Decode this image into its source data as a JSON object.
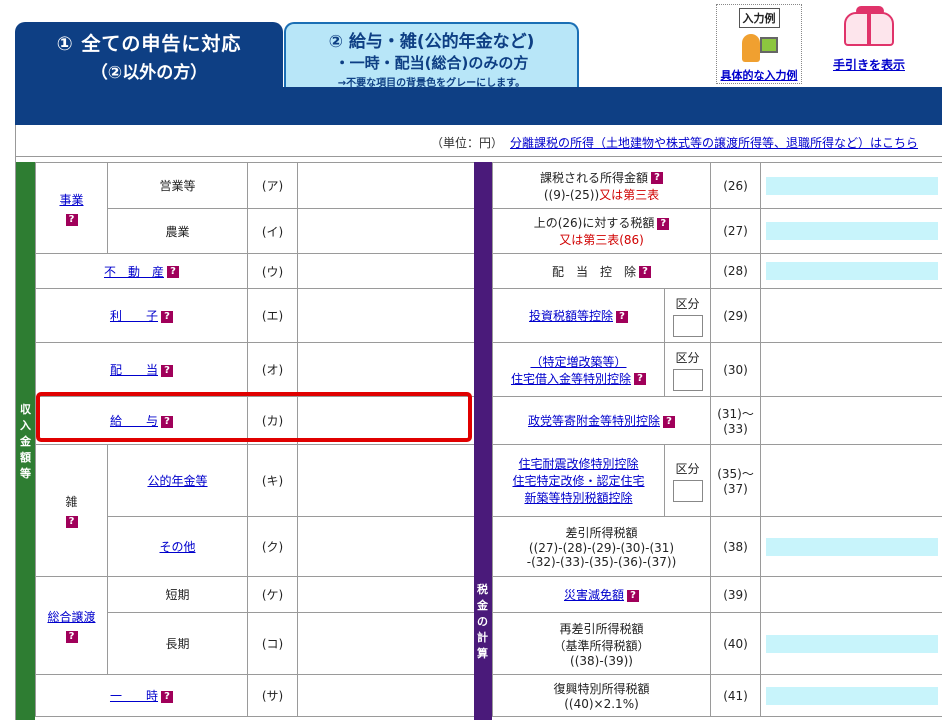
{
  "header": {
    "tab1_line1": "① 全ての申告に対応",
    "tab1_line2": "（②以外の方）",
    "tab2_line1": "② 給与・雑(公的年金など)",
    "tab2_line2": "・一時・配当(総合)のみの方",
    "tab2_note": "→不要な項目の背景色をグレーにします。",
    "example_badge": "入力例",
    "example_link": "具体的な入力例",
    "guide_link": "手引きを表示"
  },
  "unit_label": "（単位：円）",
  "separate_income_link": "分離課税の所得（土地建物や株式等の譲渡所得等、退職所得など）はこちら",
  "sidebar_income": "収入金額等",
  "sidebar_tax": "税金の計算",
  "help_mark": "?",
  "income": {
    "business": "事業",
    "business_rows": [
      {
        "label": "営業等",
        "code": "(ア)"
      },
      {
        "label": "農業",
        "code": "(イ)"
      }
    ],
    "real_estate": {
      "label": "不　動　産",
      "code": "(ウ)"
    },
    "interest": {
      "label": "利　　子",
      "code": "(エ)"
    },
    "dividend": {
      "label": "配　　当",
      "code": "(オ)"
    },
    "salary": {
      "label": "給　　与",
      "code": "(カ)"
    },
    "misc": "雑",
    "misc_rows": [
      {
        "label": "公的年金等",
        "code": "(キ)"
      },
      {
        "label": "その他",
        "code": "(ク)"
      }
    ],
    "transfer": "総合譲渡",
    "transfer_rows": [
      {
        "label": "短期",
        "code": "(ケ)"
      },
      {
        "label": "長期",
        "code": "(コ)"
      }
    ],
    "temporary": {
      "label": "一　　時",
      "code": "(サ)"
    }
  },
  "tax": {
    "r26": {
      "label1": "課税される所得金額",
      "label2": "((9)-(25))",
      "label2_red": "又は第三表",
      "code": "(26)"
    },
    "r27": {
      "label1": "上の(26)に対する税額",
      "label2_red": "又は第三表(86)",
      "code": "(27)"
    },
    "r28": {
      "label": "配　当　控　除",
      "code": "(28)"
    },
    "r29": {
      "label": "投資税額等控除",
      "kubun": "区分",
      "code": "(29)"
    },
    "r30": {
      "label1": "（特定増改築等）",
      "label2": "住宅借入金等特別控除",
      "kubun": "区分",
      "code": "(30)"
    },
    "r31": {
      "label": "政党等寄附金等特別控除",
      "code1": "(31)～",
      "code2": "(33)"
    },
    "r35": {
      "label1": "住宅耐震改修特別控除",
      "label2": "住宅特定改修・認定住宅",
      "label3": "新築等特別税額控除",
      "kubun": "区分",
      "code1": "(35)～",
      "code2": "(37)"
    },
    "r38": {
      "label1": "差引所得税額",
      "label2": "((27)-(28)-(29)-(30)-(31)",
      "label3": "-(32)-(33)-(35)-(36)-(37))",
      "code": "(38)"
    },
    "r39": {
      "label": "災害減免額",
      "code": "(39)"
    },
    "r40": {
      "label1": "再差引所得税額",
      "label2": "（基準所得税額）",
      "label3": "((38)-(39))",
      "code": "(40)"
    },
    "r41": {
      "label1": "復興特別所得税額",
      "label2": "((40)×2.1%)",
      "code": "(41)"
    }
  }
}
